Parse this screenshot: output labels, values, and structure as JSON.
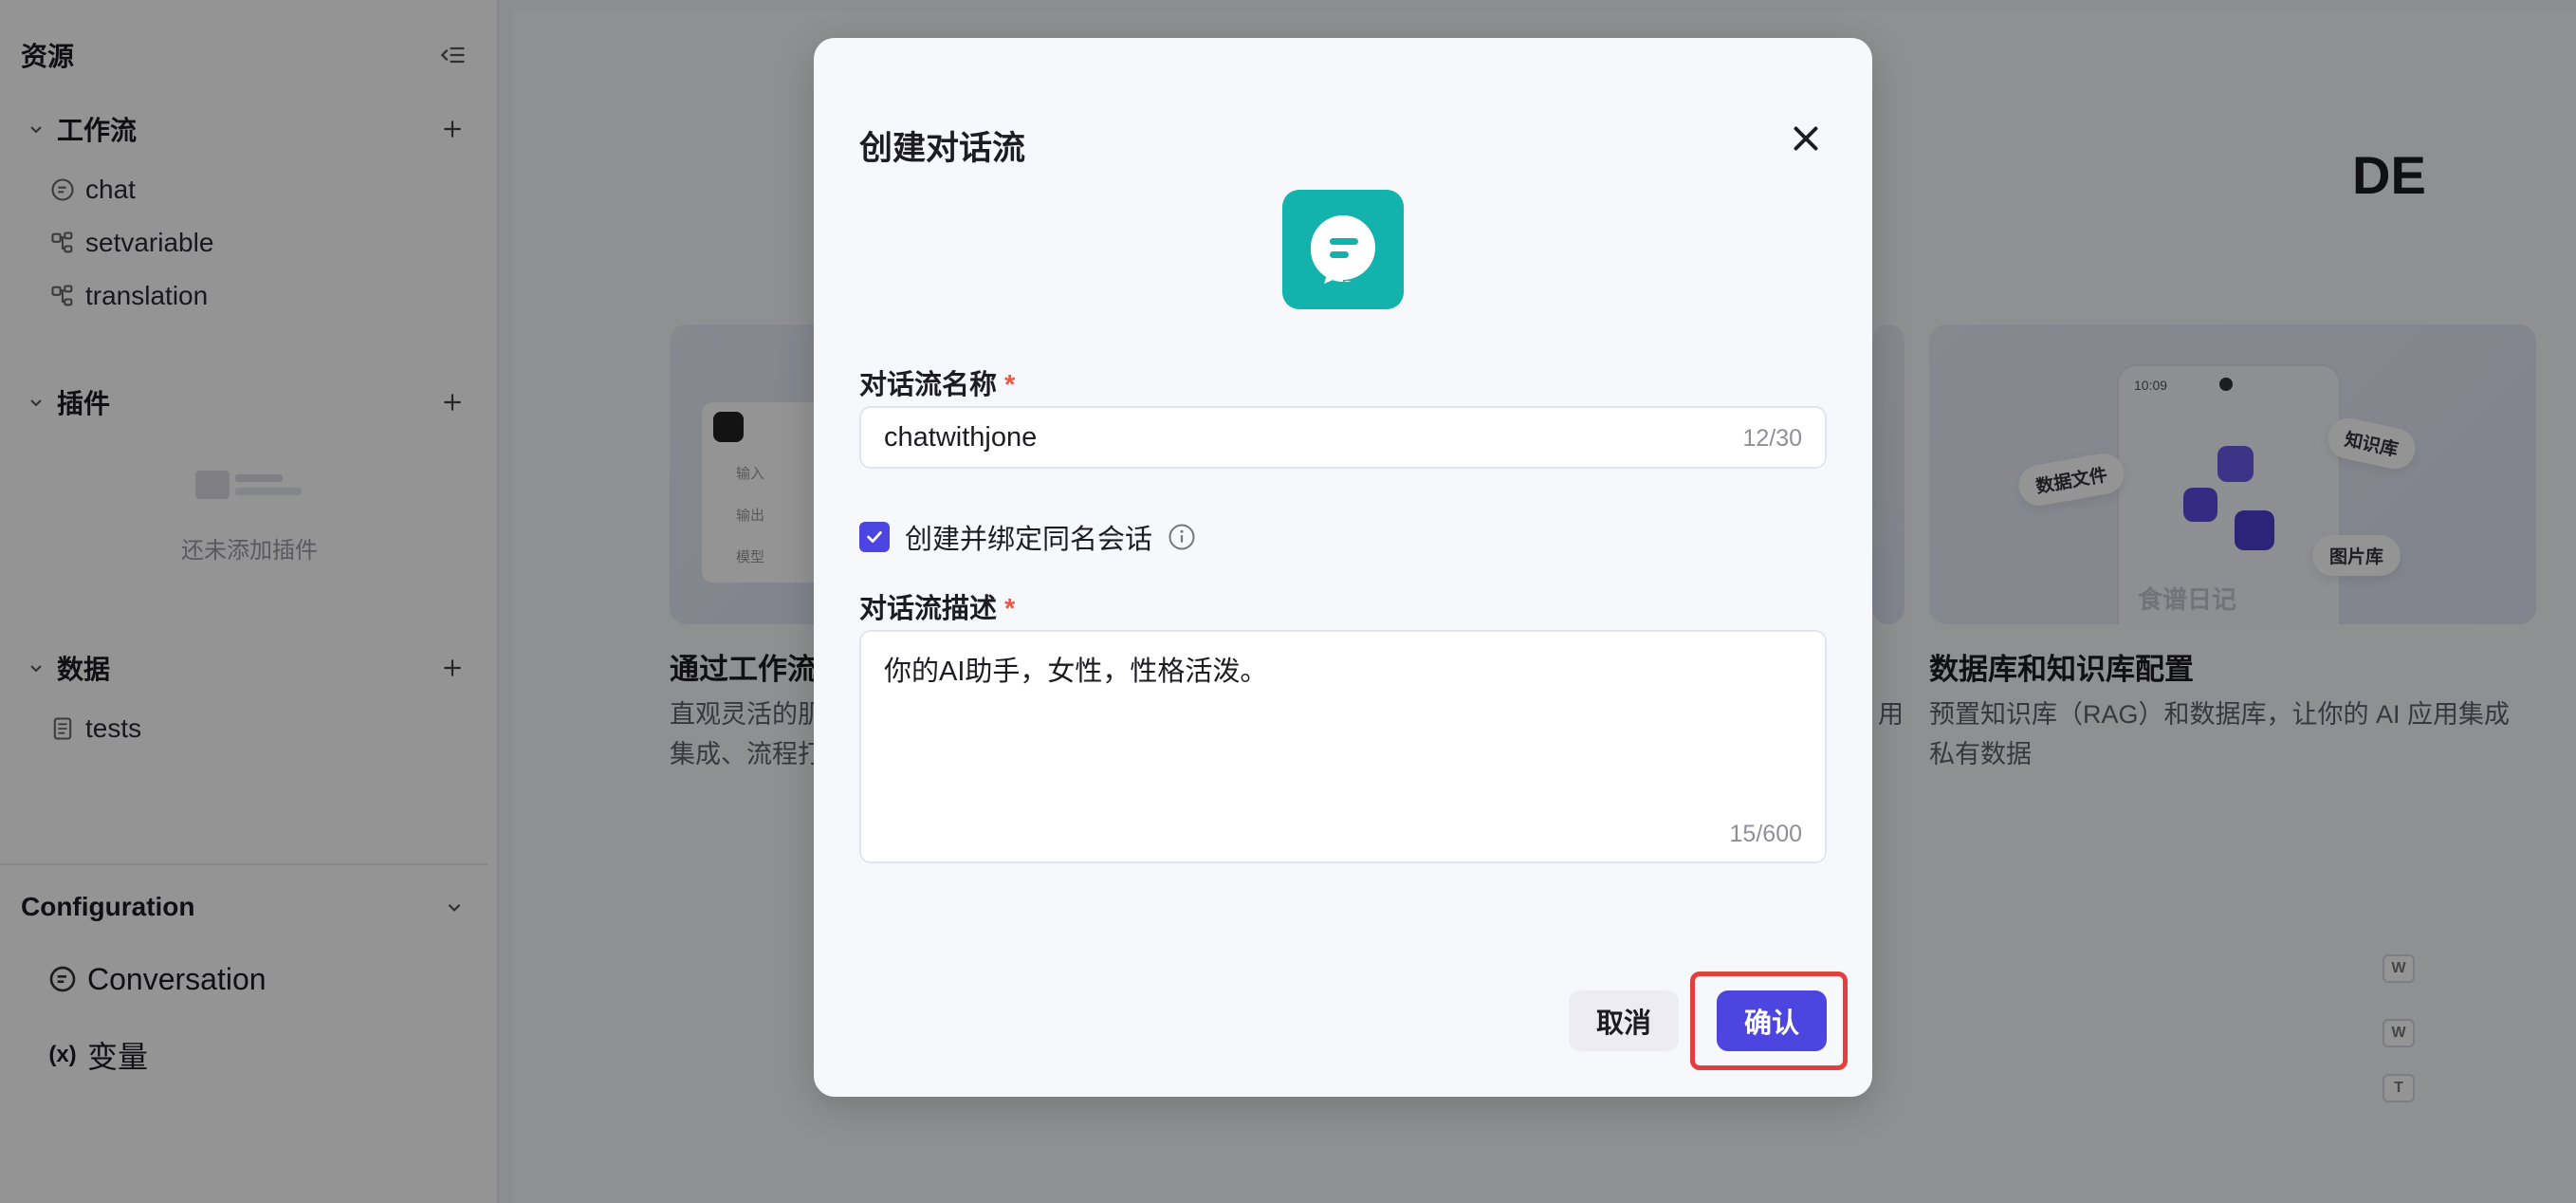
{
  "sidebar": {
    "title": "资源",
    "groups": [
      {
        "label": "工作流",
        "items": [
          "chat",
          "setvariable",
          "translation"
        ]
      },
      {
        "label": "插件",
        "empty_text": "还未添加插件"
      },
      {
        "label": "数据",
        "items": [
          "tests"
        ]
      }
    ],
    "configuration": {
      "title": "Configuration",
      "items": [
        "Conversation",
        "变量"
      ]
    }
  },
  "main": {
    "hero_partial": "DE",
    "cards": [
      {
        "title": "通过工作流",
        "desc_line1": "直观灵活的肌",
        "desc_line2": "集成、流程打"
      },
      {
        "title": "数据库和知识库配置",
        "desc_line1": "预置知识库（RAG）和数据库，让你的 AI 应用集成",
        "desc_line2": "私有数据",
        "side_fragment": "用",
        "illustration": {
          "time": "10:09",
          "chip_data_file": "数据文件",
          "chip_knowledge": "知识库",
          "chip_image": "图片库",
          "caption": "食谱日记"
        }
      }
    ],
    "shortcut_keys": [
      "W",
      "W",
      "T"
    ],
    "left_card_fields": [
      "输入",
      "输出",
      "模型"
    ]
  },
  "modal": {
    "title": "创建对话流",
    "name_label": "对话流名称",
    "name_value": "chatwithjone",
    "name_count": "12/30",
    "bind_checkbox_label": "创建并绑定同名会话",
    "bind_checked": true,
    "desc_label": "对话流描述",
    "desc_value": "你的AI助手，女性，性格活泼。",
    "desc_count": "15/600",
    "cancel_label": "取消",
    "confirm_label": "确认",
    "required_mark": "*"
  },
  "colors": {
    "accent": "#4c45e0",
    "app_icon": "#13b2ad",
    "highlight": "#e43f3f"
  }
}
